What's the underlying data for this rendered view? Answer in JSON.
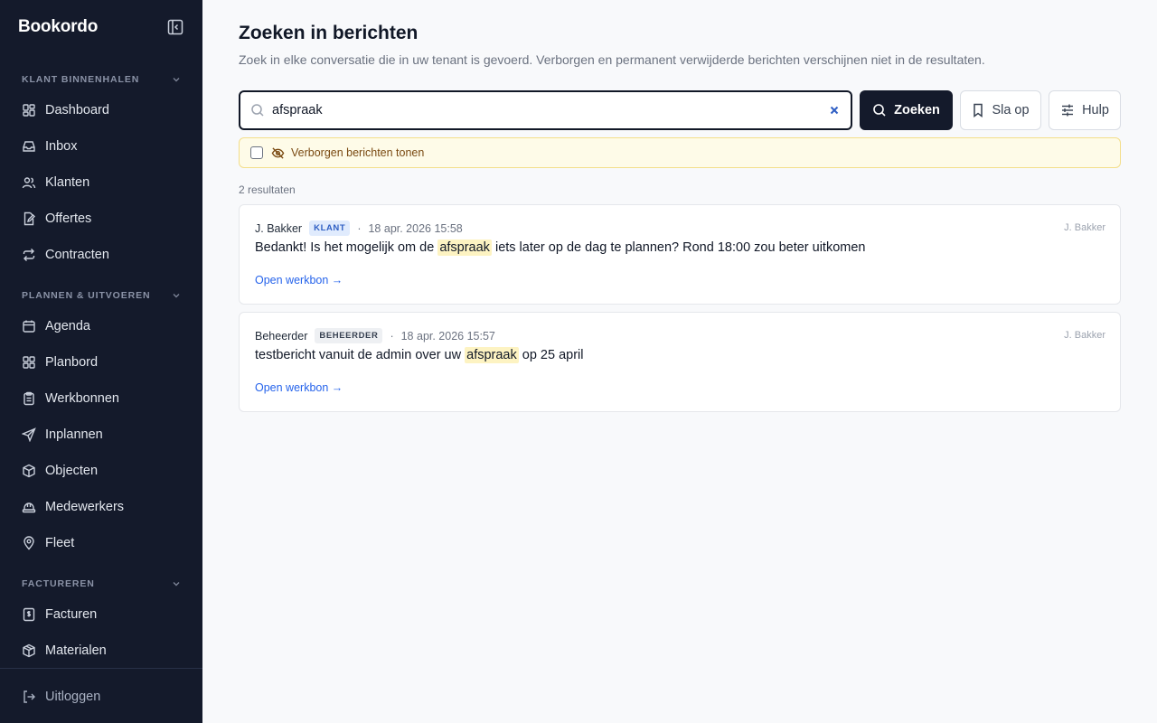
{
  "app": {
    "brand": "Bookordo"
  },
  "sidebar": {
    "sections": [
      {
        "title": "KLANT BINNENHALEN",
        "items": [
          {
            "label": "Dashboard",
            "icon": "dashboard-icon"
          },
          {
            "label": "Inbox",
            "icon": "inbox-icon"
          },
          {
            "label": "Klanten",
            "icon": "users-icon"
          },
          {
            "label": "Offertes",
            "icon": "document-edit-icon"
          },
          {
            "label": "Contracten",
            "icon": "repeat-icon"
          }
        ]
      },
      {
        "title": "PLANNEN & UITVOEREN",
        "items": [
          {
            "label": "Agenda",
            "icon": "calendar-icon"
          },
          {
            "label": "Planbord",
            "icon": "board-icon"
          },
          {
            "label": "Werkbonnen",
            "icon": "clipboard-icon"
          },
          {
            "label": "Inplannen",
            "icon": "send-icon"
          },
          {
            "label": "Objecten",
            "icon": "box-icon"
          },
          {
            "label": "Medewerkers",
            "icon": "hardhat-icon"
          },
          {
            "label": "Fleet",
            "icon": "map-pin-icon"
          }
        ]
      },
      {
        "title": "FACTUREREN",
        "items": [
          {
            "label": "Facturen",
            "icon": "invoice-icon"
          },
          {
            "label": "Materialen",
            "icon": "package-icon"
          }
        ]
      }
    ],
    "logout": "Uitloggen"
  },
  "page": {
    "title": "Zoeken in berichten",
    "subtitle": "Zoek in elke conversatie die in uw tenant is gevoerd. Verborgen en permanent verwijderde berichten verschijnen niet in de resultaten."
  },
  "search": {
    "value": "afspraak",
    "button_label": "Zoeken",
    "save_label": "Sla op",
    "help_label": "Hulp"
  },
  "hidden_toggle": {
    "label": "Verborgen berichten tonen",
    "checked": false
  },
  "results": {
    "count_text": "2 resultaten",
    "items": [
      {
        "author": "J. Bakker",
        "role": "KLANT",
        "date": "18 apr. 2026 15:58",
        "customer": "J. Bakker",
        "text_before": "Bedankt! Is het mogelijk om de ",
        "highlight": "afspraak",
        "text_after": " iets later op de dag te plannen? Rond 18:00 zou beter uitkomen",
        "link": "Open werkbon →"
      },
      {
        "author": "Beheerder",
        "role": "BEHEERDER",
        "date": "18 apr. 2026 15:57",
        "customer": "J. Bakker",
        "text_before": "testbericht vanuit de admin over uw ",
        "highlight": "afspraak",
        "text_after": " op 25 april",
        "link": "Open werkbon →"
      }
    ]
  },
  "colors": {
    "sidebar_bg": "#141a2b",
    "primary": "#141a2b",
    "highlight": "#fdf3c2",
    "link": "#2563eb",
    "warning_bg": "#fefbe8"
  }
}
